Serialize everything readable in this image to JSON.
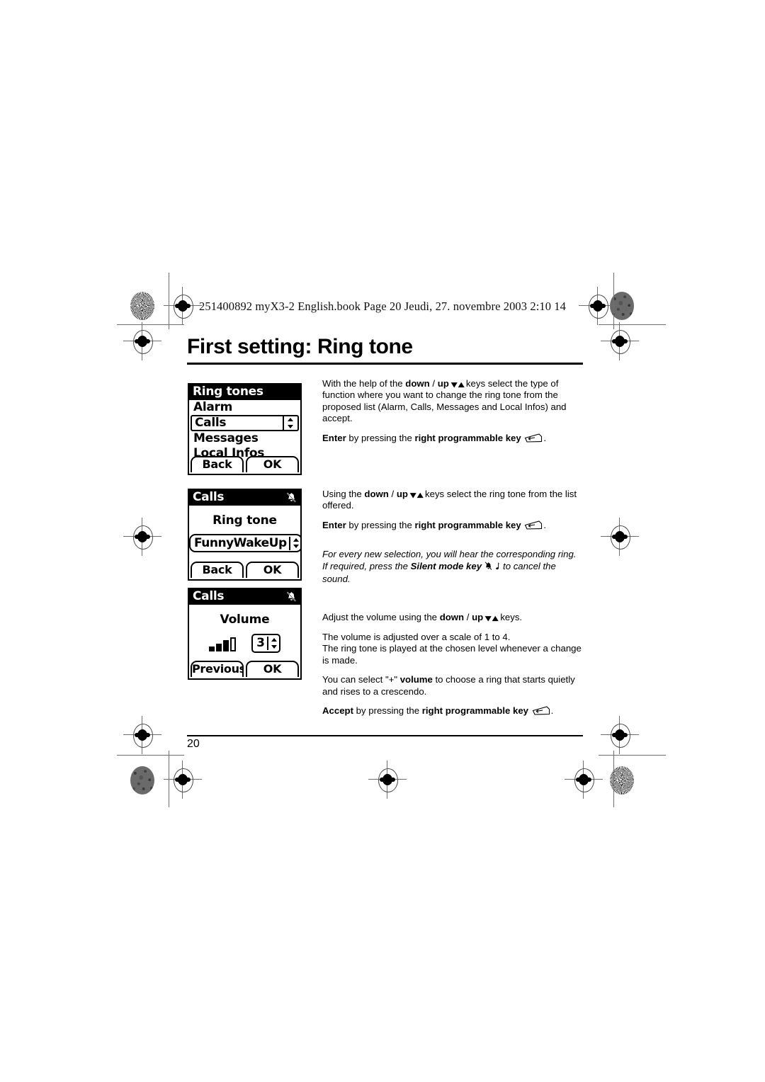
{
  "document": {
    "header_line": "251400892 myX3-2 English.book  Page 20  Jeudi, 27. novembre 2003  2:10 14",
    "title": "First setting: Ring tone",
    "page_number": "20"
  },
  "screens": {
    "ring_tones": {
      "title": "Ring tones",
      "items": [
        {
          "label": "Alarm",
          "selected": false
        },
        {
          "label": "Calls",
          "selected": true
        },
        {
          "label": "Messages",
          "selected": false
        },
        {
          "label": "Local Infos",
          "selected": false
        }
      ],
      "softkey_left": "Back",
      "softkey_right": "OK"
    },
    "ring_tone_select": {
      "title": "Calls",
      "status_icon": "bell-muted-icon",
      "label": "Ring tone",
      "value": "FunnyWakeUp",
      "softkey_left": "Back",
      "softkey_right": "OK"
    },
    "volume": {
      "title": "Calls",
      "status_icon": "bell-muted-icon",
      "label": "Volume",
      "value": "3",
      "bars_filled": 3,
      "bars_total": 4,
      "softkey_left": "Previous",
      "softkey_right": "OK"
    }
  },
  "body": {
    "p1_a": "With the help of the ",
    "p1_down": "down",
    "p1_sep": " / ",
    "p1_up": "up",
    "p1_b": " keys select the type of function where you want to change the ring tone from the proposed list (Alarm, Calls, Messages and Local Infos) and accept.",
    "p2_enter": "Enter",
    "p2_mid": " by pressing the ",
    "p2_key": "right programmable key",
    "p2_end": ".",
    "p3_a": "Using the ",
    "p3_down": "down",
    "p3_sep": " / ",
    "p3_up": "up",
    "p3_b": " keys select the ring tone  from the list offered.",
    "p4_enter": "Enter",
    "p4_mid": " by pressing the ",
    "p4_key": "right programmable key",
    "p4_end": ".",
    "p5_line1": "For every new selection, you will hear the corresponding ring.",
    "p5_a": "If required, press the ",
    "p5_key": "Silent mode key",
    "p5_b": " to cancel the sound.",
    "p6_a": "Adjust the volume using the ",
    "p6_down": "down",
    "p6_sep": " / ",
    "p6_up": "up",
    "p6_b": " keys.",
    "p7_line1": "The volume is adjusted over a scale of 1 to 4.",
    "p7_line2": "The ring tone is played at the chosen level whenever a change is made.",
    "p8_a": "You can select \"+\" ",
    "p8_vol": "volume",
    "p8_b": " to choose a ring that starts quietly and rises to a crescendo.",
    "p9_accept": "Accept",
    "p9_mid": " by pressing the ",
    "p9_key": "right programmable key",
    "p9_end": "."
  },
  "icons": {
    "chevron_down": "▾",
    "chevron_up": "▴"
  }
}
